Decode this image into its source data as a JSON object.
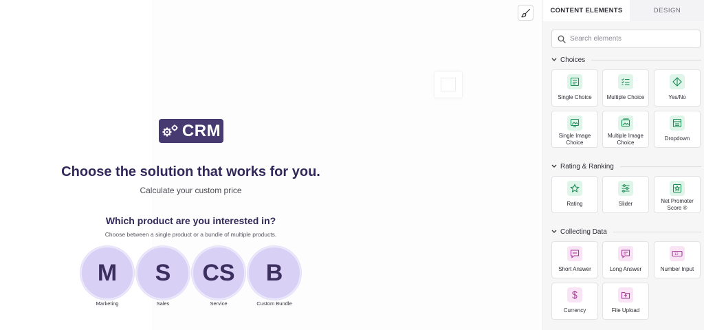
{
  "colors": {
    "brand": "#473a71",
    "circle": "#d8d0f5",
    "heading": "#33285a",
    "green_icon": "#1e8a56",
    "pink_icon": "#a33a93"
  },
  "canvas": {
    "logo_text": "CRM",
    "headline": "Choose the solution that works for you.",
    "subhead": "Calculate your custom price",
    "question": "Which product are you interested in?",
    "hint": "Choose between a single product or a bundle of multiple products.",
    "choices": [
      {
        "letter": "M",
        "label": "Marketing"
      },
      {
        "letter": "S",
        "label": "Sales"
      },
      {
        "letter": "CS",
        "label": "Service"
      },
      {
        "letter": "B",
        "label": "Custom Bundle"
      }
    ]
  },
  "sidebar": {
    "tabs": {
      "active": "CONTENT ELEMENTS",
      "inactive": "DESIGN"
    },
    "search": {
      "placeholder": "Search elements",
      "value": ""
    },
    "sections": {
      "choices": {
        "title": "Choices",
        "items": [
          {
            "label": "Single Choice",
            "icon": "single-choice-icon"
          },
          {
            "label": "Multiple Choice",
            "icon": "multiple-choice-icon"
          },
          {
            "label": "Yes/No",
            "icon": "yes-no-icon"
          },
          {
            "label": "Single Image Choice",
            "icon": "single-image-icon"
          },
          {
            "label": "Multiple Image Choice",
            "icon": "multiple-image-icon"
          },
          {
            "label": "Dropdown",
            "icon": "dropdown-icon"
          }
        ]
      },
      "rating": {
        "title": "Rating & Ranking",
        "items": [
          {
            "label": "Rating",
            "icon": "star-icon"
          },
          {
            "label": "Slider",
            "icon": "slider-icon"
          },
          {
            "label": "Net Promoter Score ®",
            "icon": "nps-icon"
          }
        ]
      },
      "collecting": {
        "title": "Collecting Data",
        "items": [
          {
            "label": "Short Answer",
            "icon": "short-answer-icon"
          },
          {
            "label": "Long Answer",
            "icon": "long-answer-icon"
          },
          {
            "label": "Number Input",
            "icon": "number-input-icon"
          },
          {
            "label": "Currency",
            "icon": "dollar-icon"
          },
          {
            "label": "File Upload",
            "icon": "file-upload-icon"
          }
        ]
      }
    }
  }
}
